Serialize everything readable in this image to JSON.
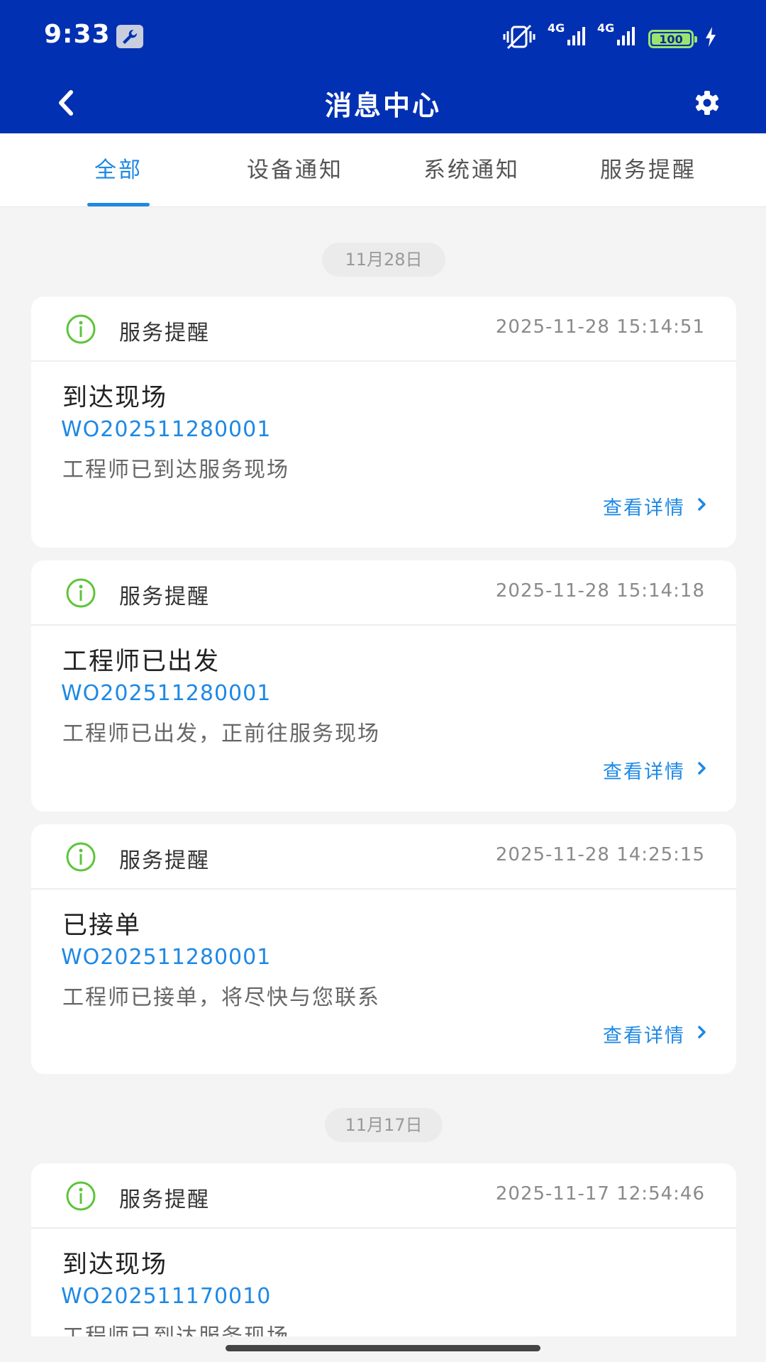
{
  "status_bar": {
    "time": "9:33",
    "signal1": "4G",
    "signal2": "4G",
    "battery": "100"
  },
  "header": {
    "title": "消息中心"
  },
  "tabs": [
    {
      "label": "全部",
      "active": true
    },
    {
      "label": "设备通知",
      "active": false
    },
    {
      "label": "系统通知",
      "active": false
    },
    {
      "label": "服务提醒",
      "active": false
    }
  ],
  "groups": [
    {
      "date": "11月28日",
      "cards": [
        {
          "type": "服务提醒",
          "time": "2025-11-28 15:14:51",
          "title": "到达现场",
          "order_no": "WO202511280001",
          "desc": "工程师已到达服务现场",
          "link": "查看详情"
        },
        {
          "type": "服务提醒",
          "time": "2025-11-28 15:14:18",
          "title": "工程师已出发",
          "order_no": "WO202511280001",
          "desc": "工程师已出发，正前往服务现场",
          "link": "查看详情"
        },
        {
          "type": "服务提醒",
          "time": "2025-11-28 14:25:15",
          "title": "已接单",
          "order_no": "WO202511280001",
          "desc": "工程师已接单，将尽快与您联系",
          "link": "查看详情"
        }
      ]
    },
    {
      "date": "11月17日",
      "cards": [
        {
          "type": "服务提醒",
          "time": "2025-11-17 12:54:46",
          "title": "到达现场",
          "order_no": "WO202511170010",
          "desc": "工程师已到达服务现场"
        }
      ]
    }
  ],
  "colors": {
    "header_bg": "#0230b2",
    "accent": "#1e88e5",
    "info_icon": "#5ec43a"
  },
  "icons": {
    "back": "chevron-left-icon",
    "settings": "gear-icon",
    "info": "info-circle-icon",
    "link_chevron": "chevron-right-icon"
  }
}
